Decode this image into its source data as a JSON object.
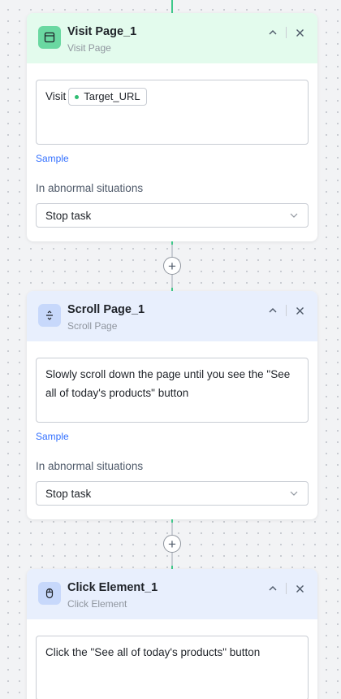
{
  "connector_add_label": "+",
  "nodes": [
    {
      "title": "Visit Page_1",
      "subtitle": "Visit Page",
      "icon": "browser-window-icon",
      "prefix_text": "Visit",
      "variable_chip": "Target_URL",
      "sample_label": "Sample",
      "abnormal_label": "In abnormal situations",
      "abnormal_value": "Stop task"
    },
    {
      "title": "Scroll Page_1",
      "subtitle": "Scroll Page",
      "icon": "scroll-icon",
      "instruction": "Slowly scroll down the page until you see the \"See all of today's products\" button",
      "sample_label": "Sample",
      "abnormal_label": "In abnormal situations",
      "abnormal_value": "Stop task"
    },
    {
      "title": "Click Element_1",
      "subtitle": "Click Element",
      "icon": "mouse-icon",
      "instruction": "Click the \"See all of today's products\" button"
    }
  ],
  "colors": {
    "visit_header": "#e3fbed",
    "scroll_header": "#e8effd",
    "connector": "#3fc98a",
    "link": "#3370ff"
  }
}
